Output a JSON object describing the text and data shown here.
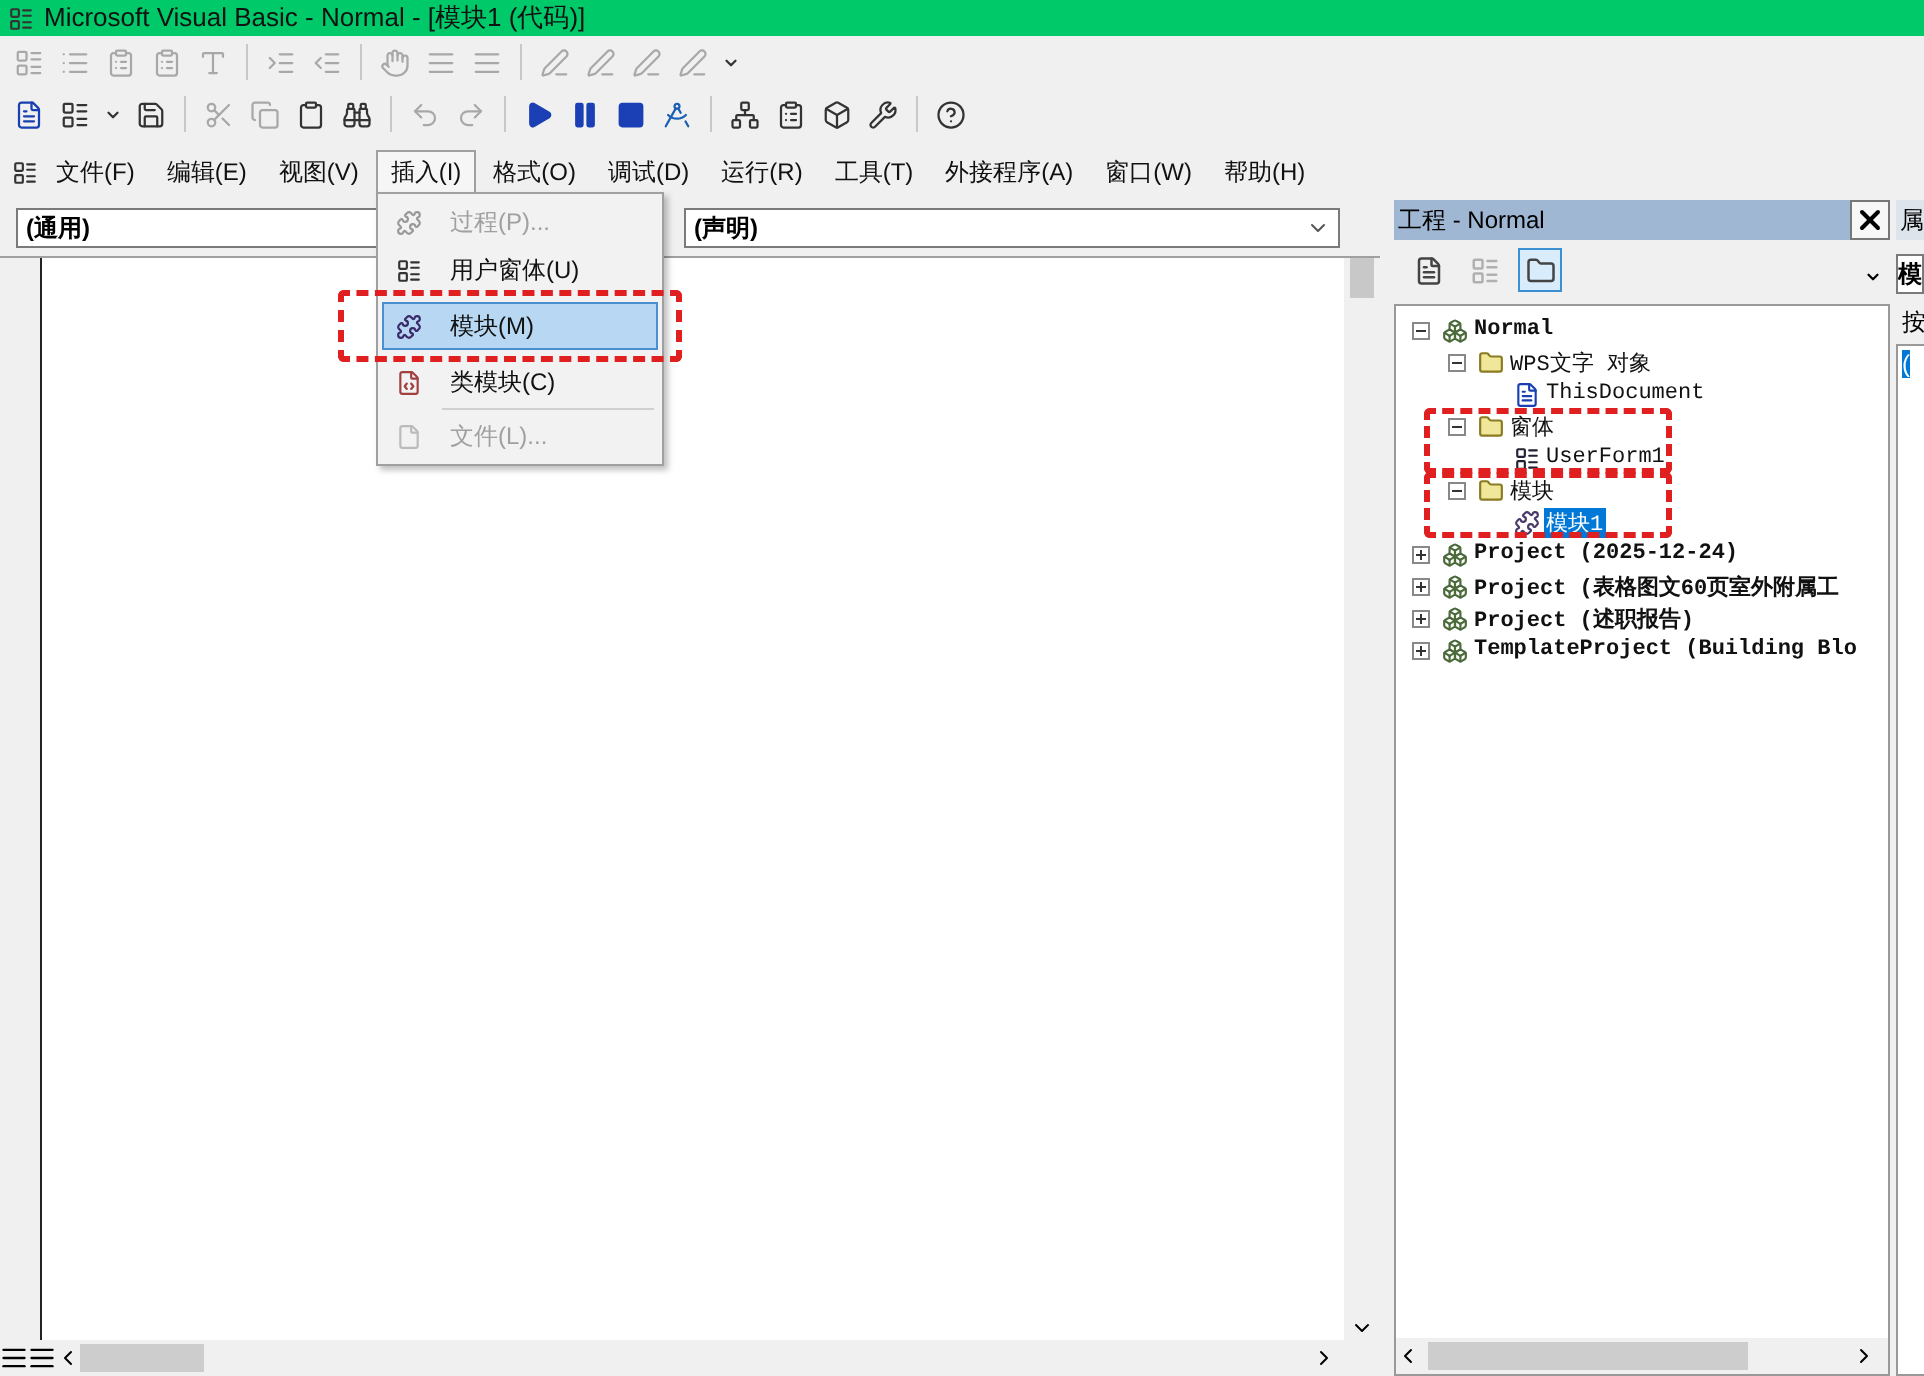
{
  "window": {
    "title": "Microsoft Visual Basic - Normal - [模块1 (代码)]"
  },
  "toolbars": [
    {
      "buttons": [
        {
          "kind": "form",
          "disabled": true
        },
        {
          "kind": "list",
          "disabled": true
        },
        {
          "kind": "props",
          "disabled": true
        },
        {
          "kind": "props",
          "disabled": true
        },
        {
          "kind": "font",
          "disabled": true
        },
        {
          "kind": "sep"
        },
        {
          "kind": "indent",
          "disabled": true
        },
        {
          "kind": "outdent",
          "disabled": true
        },
        {
          "kind": "sep"
        },
        {
          "kind": "hand",
          "disabled": true
        },
        {
          "kind": "lines",
          "disabled": true
        },
        {
          "kind": "lines",
          "disabled": true
        },
        {
          "kind": "sep"
        },
        {
          "kind": "pen",
          "disabled": true
        },
        {
          "kind": "pen",
          "disabled": true
        },
        {
          "kind": "pen",
          "disabled": true
        },
        {
          "kind": "pen",
          "disabled": true
        },
        {
          "kind": "caret",
          "disabled": false
        }
      ]
    },
    {
      "buttons": [
        {
          "kind": "doc",
          "disabled": false
        },
        {
          "kind": "form",
          "disabled": false
        },
        {
          "kind": "caret",
          "disabled": false
        },
        {
          "kind": "save",
          "disabled": false
        },
        {
          "kind": "sep"
        },
        {
          "kind": "cut",
          "disabled": true
        },
        {
          "kind": "copy",
          "disabled": true
        },
        {
          "kind": "paste",
          "disabled": false
        },
        {
          "kind": "find",
          "disabled": false
        },
        {
          "kind": "sep"
        },
        {
          "kind": "undo",
          "disabled": true
        },
        {
          "kind": "redo",
          "disabled": true
        },
        {
          "kind": "sep"
        },
        {
          "kind": "run",
          "disabled": false
        },
        {
          "kind": "pause",
          "disabled": false
        },
        {
          "kind": "stop",
          "disabled": false
        },
        {
          "kind": "design",
          "disabled": false
        },
        {
          "kind": "sep"
        },
        {
          "kind": "project",
          "disabled": false
        },
        {
          "kind": "props",
          "disabled": false
        },
        {
          "kind": "browser",
          "disabled": false
        },
        {
          "kind": "tools",
          "disabled": false
        },
        {
          "kind": "sep"
        },
        {
          "kind": "help",
          "disabled": false
        }
      ]
    }
  ],
  "menu_bar": [
    {
      "label": "文件(F)",
      "selected": false
    },
    {
      "label": "编辑(E)",
      "selected": false
    },
    {
      "label": "视图(V)",
      "selected": false
    },
    {
      "label": "插入(I)",
      "selected": true
    },
    {
      "label": "格式(O)",
      "selected": false
    },
    {
      "label": "调试(D)",
      "selected": false
    },
    {
      "label": "运行(R)",
      "selected": false
    },
    {
      "label": "工具(T)",
      "selected": false
    },
    {
      "label": "外接程序(A)",
      "selected": false
    },
    {
      "label": "窗口(W)",
      "selected": false
    },
    {
      "label": "帮助(H)",
      "selected": false
    }
  ],
  "insert_menu": [
    {
      "label": "过程(P)...",
      "kind": "procedure",
      "disabled": true,
      "selected": false
    },
    {
      "label": "用户窗体(U)",
      "kind": "form",
      "disabled": false,
      "selected": false
    },
    {
      "label": "模块(M)",
      "kind": "module",
      "disabled": false,
      "selected": true,
      "outlined": true
    },
    {
      "label": "类模块(C)",
      "kind": "class",
      "disabled": false,
      "selected": false
    },
    {
      "label": "文件(L)...",
      "kind": "file",
      "disabled": true,
      "selected": false,
      "separator_before": true
    }
  ],
  "code_window": {
    "object_combo": "(通用)",
    "procedure_combo": "(声明)"
  },
  "project_panel": {
    "title": "工程 - Normal",
    "view_buttons": [
      {
        "kind": "code",
        "selected": false,
        "disabled": false
      },
      {
        "kind": "object",
        "selected": false,
        "disabled": true
      },
      {
        "kind": "folders",
        "selected": true,
        "disabled": false
      }
    ],
    "tree": [
      {
        "label": "Normal",
        "kind": "project",
        "expanded": true,
        "selected": false,
        "children": [
          {
            "label": "WPS文字 对象",
            "kind": "folder",
            "expanded": true,
            "selected": false,
            "children": [
              {
                "label": "ThisDocument",
                "kind": "document",
                "selected": false
              }
            ]
          },
          {
            "label": "窗体",
            "kind": "folder",
            "expanded": true,
            "selected": false,
            "outlined": true,
            "children": [
              {
                "label": "UserForm1",
                "kind": "form",
                "selected": false
              }
            ]
          },
          {
            "label": "模块",
            "kind": "folder",
            "expanded": true,
            "selected": false,
            "outlined": true,
            "children": [
              {
                "label": "模块1",
                "kind": "module",
                "selected": true
              }
            ]
          }
        ]
      },
      {
        "label": "Project (2025-12-24)",
        "kind": "project",
        "expanded": false,
        "selected": false
      },
      {
        "label": "Project (表格图文60页室外附属工",
        "kind": "project",
        "expanded": false,
        "selected": false
      },
      {
        "label": "Project (述职报告)",
        "kind": "project",
        "expanded": false,
        "selected": false
      },
      {
        "label": "TemplateProject (Building Blo",
        "kind": "project",
        "expanded": false,
        "selected": false
      }
    ]
  },
  "properties_panel": {
    "title": "属",
    "combo": "模",
    "tab": "按",
    "item": "("
  }
}
